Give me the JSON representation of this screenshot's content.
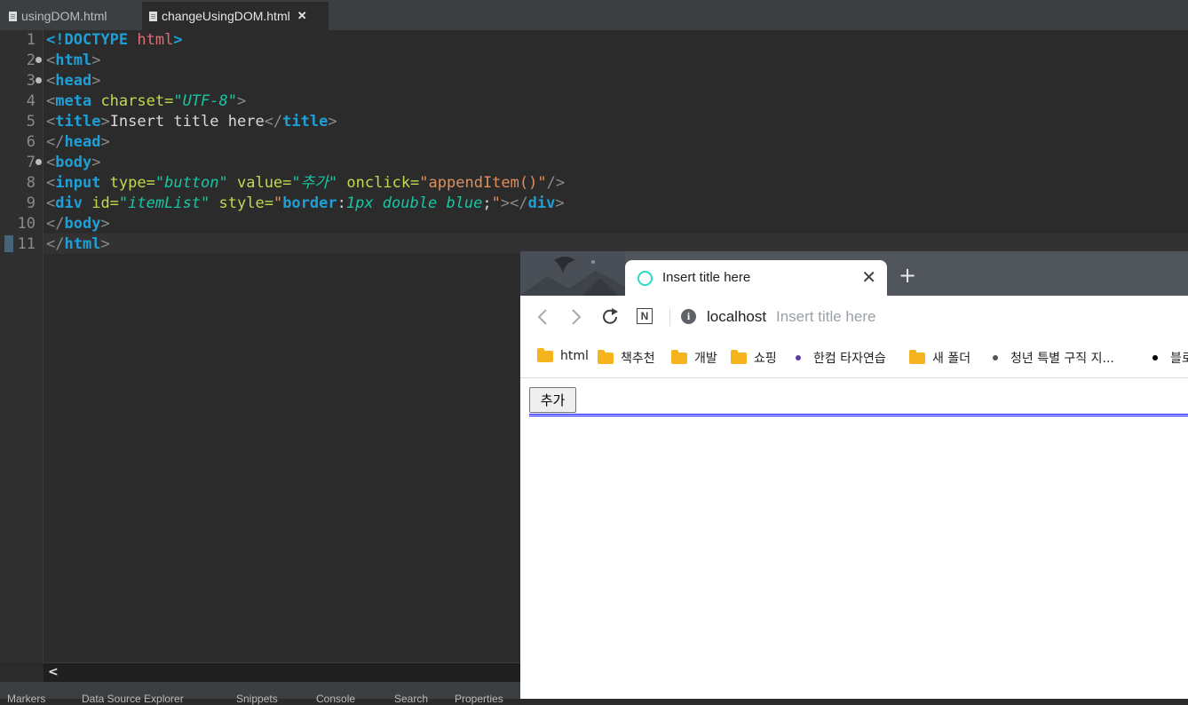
{
  "editor": {
    "tabs": [
      {
        "label": "usingDOM.html",
        "active": false
      },
      {
        "label": "changeUsingDOM.html",
        "active": true,
        "close": "✕"
      }
    ],
    "line_numbers": [
      "1",
      "2",
      "3",
      "4",
      "5",
      "6",
      "7",
      "8",
      "9",
      "10",
      "11"
    ],
    "scroll_left": "<",
    "bottom_views": [
      "Markers",
      "Data Source Explorer",
      "Snippets",
      "Console",
      "Search",
      "Properties"
    ]
  },
  "browser": {
    "tab_title": "Insert title here",
    "close_tab": "✕",
    "new_tab": "+",
    "url_host": "localhost",
    "url_page_title": "Insert title here",
    "bookmarks": [
      {
        "label": "html",
        "type": "folder"
      },
      {
        "label": "책추천",
        "type": "folder"
      },
      {
        "label": "개발",
        "type": "folder"
      },
      {
        "label": "쇼핑",
        "type": "folder"
      },
      {
        "label": "한컴 타자연습",
        "type": "site",
        "color": "#5b3ea0"
      },
      {
        "label": "새 폴더",
        "type": "folder"
      },
      {
        "label": "청년 특별 구직 지...",
        "type": "site",
        "color": "#555555"
      },
      {
        "label": "블로",
        "type": "site",
        "color": "#000000"
      }
    ],
    "page": {
      "button_value": "추가",
      "itemlist_border_color": "#0000ff"
    }
  },
  "colors": {
    "editor_bg": "#2b2b2b",
    "tag": "#1e9fd8",
    "attribute": "#c2d94f",
    "value": "#17c6a3",
    "string": "#e08e5c",
    "browser_frame": "#50555c"
  }
}
